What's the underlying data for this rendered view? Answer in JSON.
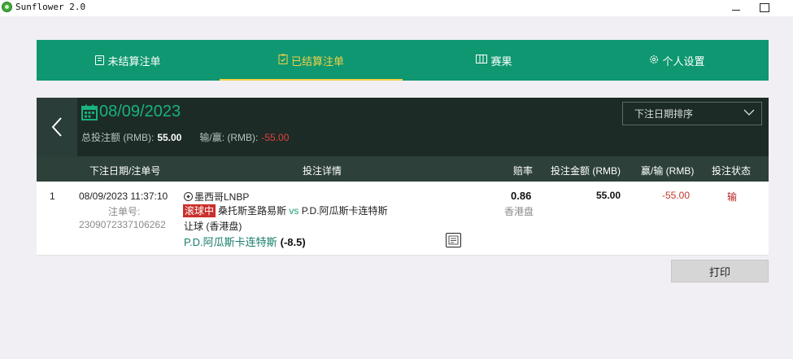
{
  "window": {
    "title": "Sunflower 2.0"
  },
  "nav": {
    "tabs": [
      {
        "label": "未结算注单",
        "icon": "document-icon"
      },
      {
        "label": "已结算注单",
        "icon": "clipboard-check-icon",
        "active": true
      },
      {
        "label": "赛果",
        "icon": "grid-icon"
      },
      {
        "label": "个人设置",
        "icon": "gear-icon"
      }
    ]
  },
  "header": {
    "date": "08/09/2023",
    "total_stake_label": "总投注额 (RMB):",
    "total_stake_value": "55.00",
    "win_loss_label": "输/赢: (RMB):",
    "win_loss_value": "-55.00",
    "sort_select_value": "下注日期排序"
  },
  "table": {
    "columns": [
      "下注日期/注单号",
      "投注详情",
      "赔率",
      "投注金额 (RMB)",
      "赢/输 (RMB)",
      "投注状态"
    ],
    "rows": [
      {
        "index": "1",
        "datetime": "08/09/2023 11:37:10",
        "ticket_label": "注单号:",
        "ticket_no": "2309072337106262",
        "league": "墨西哥LNBP",
        "live_badge": "滚球中",
        "home": "桑托斯圣路易斯",
        "vs": "vs",
        "away": "P.D.阿瓜斯卡连特斯",
        "market": "让球 (香港盘)",
        "pick": "P.D.阿瓜斯卡连特斯",
        "pick_handicap": "(-8.5)",
        "odds": "0.86",
        "odds_type": "香港盘",
        "stake": "55.00",
        "win_loss": "-55.00",
        "status": "输"
      }
    ]
  },
  "actions": {
    "print_label": "打印"
  },
  "colors": {
    "brand_green": "#0e9770",
    "active_tab": "#f2d04a",
    "panel_dark": "#1d2b27",
    "loss_red": "#e4403a",
    "status_red": "#b22222"
  }
}
